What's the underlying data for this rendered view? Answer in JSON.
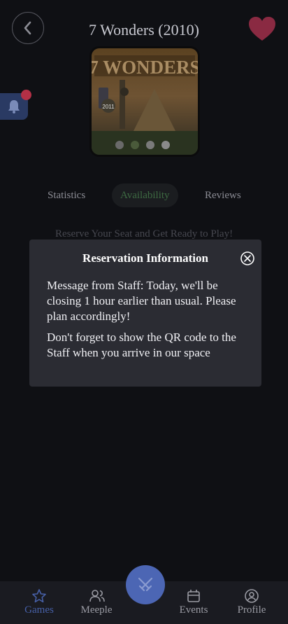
{
  "header": {
    "title": "7 Wonders (2010)"
  },
  "cover": {
    "brand_text": "7 WONDERS",
    "year_badge": "2011"
  },
  "tabs": [
    {
      "label": "Statistics"
    },
    {
      "label": "Availability"
    },
    {
      "label": "Reviews"
    }
  ],
  "availability": {
    "subtitle": "Reserve Your Seat and Get Ready to Play!"
  },
  "modal": {
    "title": "Reservation Information",
    "message_1": "Message from Staff: Today, we'll be closing 1 hour earlier than usual. Please plan accordingly!",
    "message_2": "Don't forget to show the QR code to the Staff when you arrive in our space"
  },
  "nav": {
    "items": [
      {
        "label": "Games",
        "icon": "star-icon"
      },
      {
        "label": "Meeple",
        "icon": "users-icon"
      },
      {
        "label": "Events",
        "icon": "calendar-icon"
      },
      {
        "label": "Profile",
        "icon": "user-circle-icon"
      }
    ],
    "center_icon": "swords-icon"
  },
  "colors": {
    "background": "#0f1014",
    "modal": "#2b2c33",
    "accent": "#4c66b4",
    "heart": "#8a2a42",
    "active_tab_text": "#3d6a42"
  }
}
